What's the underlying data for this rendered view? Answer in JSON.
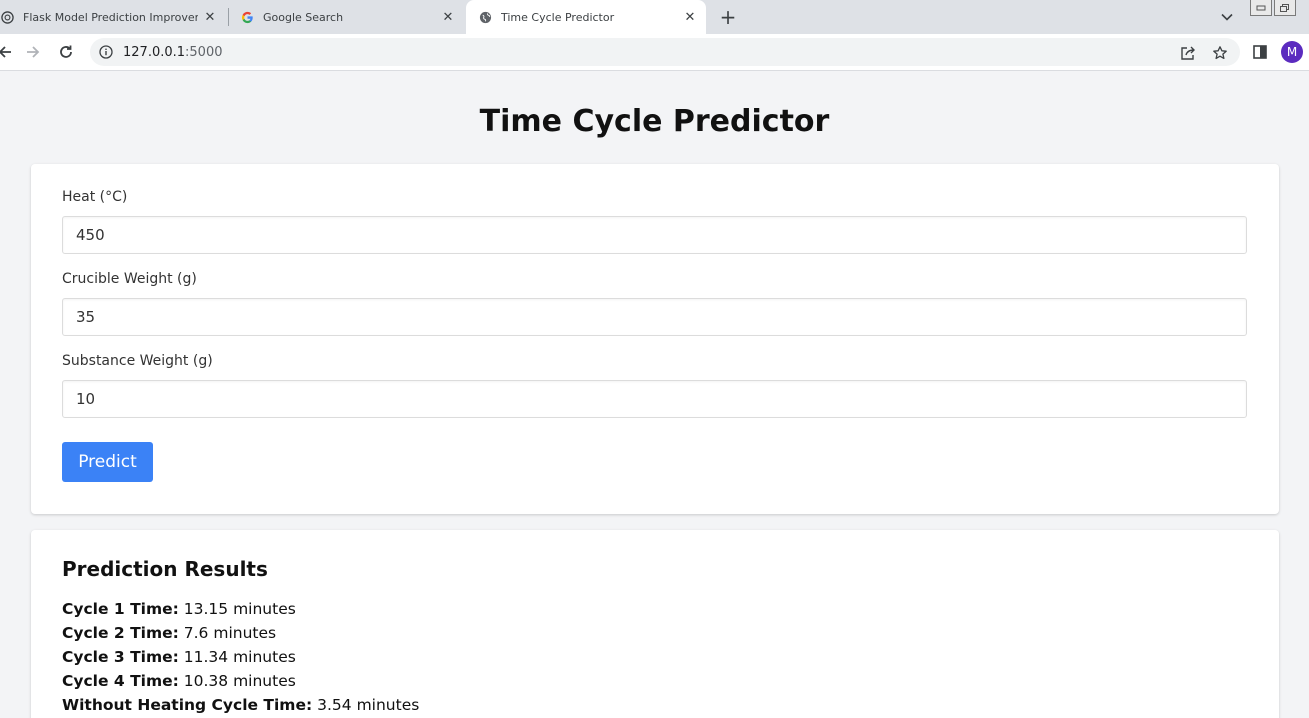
{
  "browser": {
    "tabs": [
      {
        "title": "Flask Model Prediction Improvements"
      },
      {
        "title": "Google Search"
      },
      {
        "title": "Time Cycle Predictor"
      }
    ],
    "address": {
      "host": "127.0.0.1",
      "port": ":5000"
    },
    "profile_initial": "M"
  },
  "page": {
    "title": "Time Cycle Predictor",
    "form": {
      "fields": [
        {
          "label": "Heat (°C)",
          "value": "450"
        },
        {
          "label": "Crucible Weight (g)",
          "value": "35"
        },
        {
          "label": "Substance Weight (g)",
          "value": "10"
        }
      ],
      "submit_label": "Predict"
    },
    "results": {
      "title": "Prediction Results",
      "items": [
        {
          "label": "Cycle 1 Time:",
          "value": "13.15 minutes"
        },
        {
          "label": "Cycle 2 Time:",
          "value": "7.6 minutes"
        },
        {
          "label": "Cycle 3 Time:",
          "value": "11.34 minutes"
        },
        {
          "label": "Cycle 4 Time:",
          "value": "10.38 minutes"
        },
        {
          "label": "Without Heating Cycle Time:",
          "value": "3.54 minutes"
        }
      ]
    }
  },
  "colors": {
    "accent": "#3b82f6",
    "page_bg": "#f3f4f6",
    "avatar": "#5b2bbf"
  }
}
